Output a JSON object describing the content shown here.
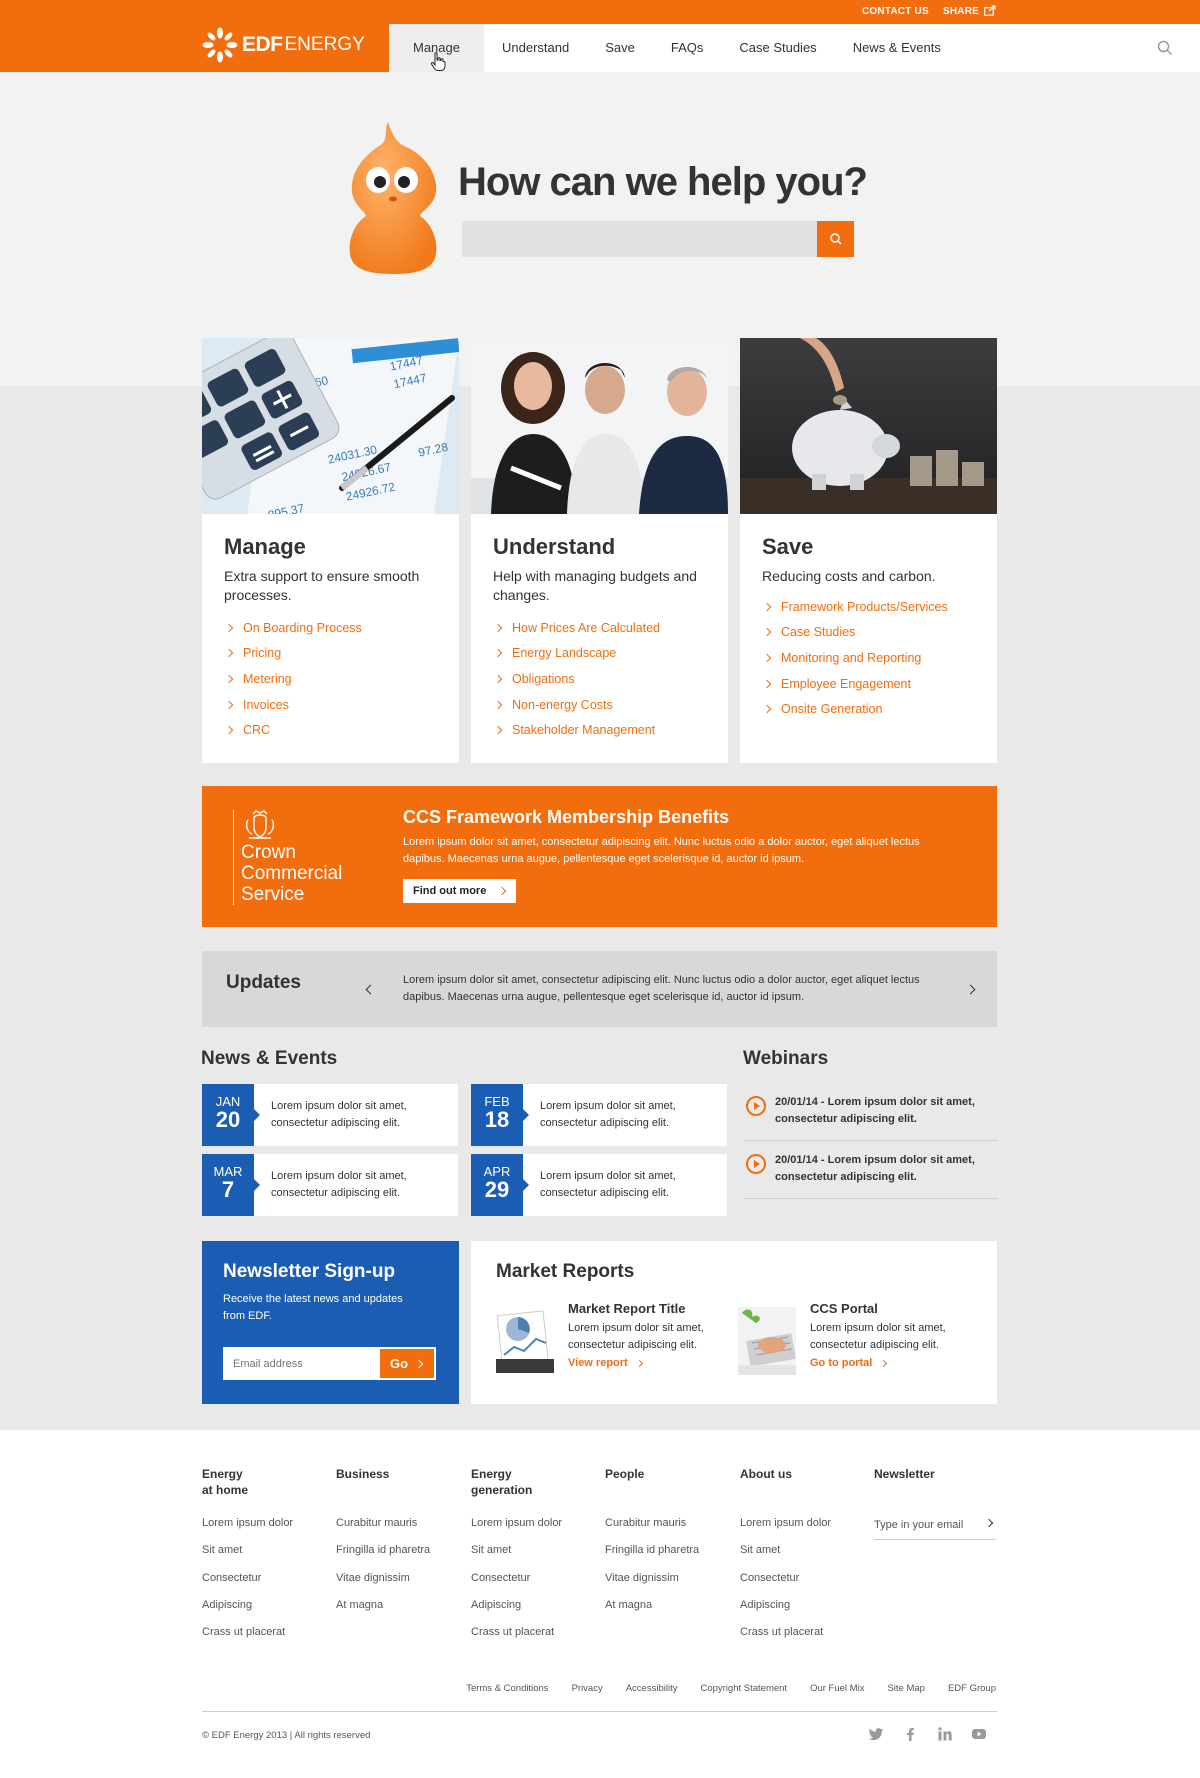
{
  "topbar": {
    "contact": "CONTACT US",
    "share": "SHARE"
  },
  "logo": {
    "part1": "EDF",
    "part2": "ENERGY"
  },
  "nav": {
    "items": [
      "Manage",
      "Understand",
      "Save",
      "FAQs",
      "Case Studies",
      "News & Events"
    ],
    "active": "Manage"
  },
  "hero": {
    "title": "How can we help you?",
    "search_placeholder": ""
  },
  "cards": [
    {
      "title": "Manage",
      "subtitle": "Extra support to ensure smooth processes.",
      "links": [
        "On Boarding Process",
        "Pricing",
        "Metering",
        "Invoices",
        "CRC"
      ]
    },
    {
      "title": "Understand",
      "subtitle": "Help with managing budgets and changes.",
      "links": [
        "How Prices Are Calculated",
        "Energy Landscape",
        "Obligations",
        "Non-energy Costs",
        "Stakeholder Management"
      ]
    },
    {
      "title": "Save",
      "subtitle": "Reducing costs and carbon.",
      "links": [
        "Framework Products/Services",
        "Case Studies",
        "Monitoring and Reporting",
        "Employee Engagement",
        "Onsite Generation"
      ]
    }
  ],
  "ccs": {
    "logo_line1": "Crown",
    "logo_line2": "Commercial",
    "logo_line3": "Service",
    "title": "CCS Framework Membership Benefits",
    "text": "Lorem ipsum dolor sit amet, consectetur adipiscing elit. Nunc luctus odio a dolor auctor, eget aliquet lectus dapibus. Maecenas urna augue, pellentesque eget scelerisque id, auctor id ipsum.",
    "button": "Find out more"
  },
  "updates": {
    "title": "Updates",
    "text": "Lorem ipsum dolor sit amet, consectetur adipiscing elit. Nunc luctus odio a dolor auctor, eget aliquet lectus dapibus. Maecenas urna augue, pellentesque eget scelerisque id, auctor id ipsum."
  },
  "news": {
    "title": "News & Events",
    "items": [
      {
        "month": "JAN",
        "day": "20",
        "text": "Lorem ipsum dolor sit amet, consectetur adipiscing elit."
      },
      {
        "month": "FEB",
        "day": "18",
        "text": "Lorem ipsum dolor sit amet, consectetur adipiscing elit."
      },
      {
        "month": "MAR",
        "day": "7",
        "text": "Lorem ipsum dolor sit amet, consectetur adipiscing elit."
      },
      {
        "month": "APR",
        "day": "29",
        "text": "Lorem ipsum dolor sit amet, consectetur adipiscing elit."
      }
    ]
  },
  "webinars": {
    "title": "Webinars",
    "items": [
      "20/01/14 - Lorem ipsum dolor sit amet, consectetur adipiscing elit.",
      "20/01/14 - Lorem ipsum dolor sit amet, consectetur adipiscing elit."
    ]
  },
  "newsletter": {
    "title": "Newsletter Sign-up",
    "text": "Receive the latest news and updates from EDF.",
    "placeholder": "Email address",
    "button": "Go"
  },
  "market": {
    "title": "Market Reports",
    "items": [
      {
        "title": "Market Report Title",
        "text": "Lorem ipsum dolor sit amet, consectetur adipiscing elit.",
        "link": "View report"
      },
      {
        "title": "CCS Portal",
        "text": "Lorem ipsum dolor sit amet, consectetur adipiscing elit.",
        "link": "Go to portal"
      }
    ]
  },
  "footer": {
    "columns": [
      {
        "title_line1": "Energy",
        "title_line2": "at home",
        "links": [
          "Lorem ipsum dolor",
          "Sit amet",
          "Consectetur",
          "Adipiscing",
          "Crass ut placerat"
        ]
      },
      {
        "title_line1": "Business",
        "title_line2": "",
        "links": [
          "Curabitur mauris",
          "Fringilla id pharetra",
          "Vitae dignissim",
          "At magna"
        ]
      },
      {
        "title_line1": "Energy",
        "title_line2": "generation",
        "links": [
          "Lorem ipsum dolor",
          "Sit amet",
          "Consectetur",
          "Adipiscing",
          "Crass ut placerat"
        ]
      },
      {
        "title_line1": "People",
        "title_line2": "",
        "links": [
          "Curabitur mauris",
          "Fringilla id pharetra",
          "Vitae dignissim",
          "At magna"
        ]
      },
      {
        "title_line1": "About us",
        "title_line2": "",
        "links": [
          "Lorem ipsum dolor",
          "Sit amet",
          "Consectetur",
          "Adipiscing",
          "Crass ut placerat"
        ]
      }
    ],
    "newsletter_title": "Newsletter",
    "newsletter_placeholder": "Type in your email",
    "legal": [
      "Terms & Conditions",
      "Privacy",
      "Accessibility",
      "Copyright Statement",
      "Our Fuel Mix",
      "Site Map",
      "EDF Group"
    ],
    "copyright": "© EDF Energy 2013   |   All rights reserved",
    "social_icons": [
      "twitter-icon",
      "facebook-icon",
      "linkedin-icon",
      "youtube-icon"
    ]
  },
  "colors": {
    "orange": "#f26d0e",
    "blue": "#1b5db3",
    "gray_bg": "#e9e9e9"
  }
}
